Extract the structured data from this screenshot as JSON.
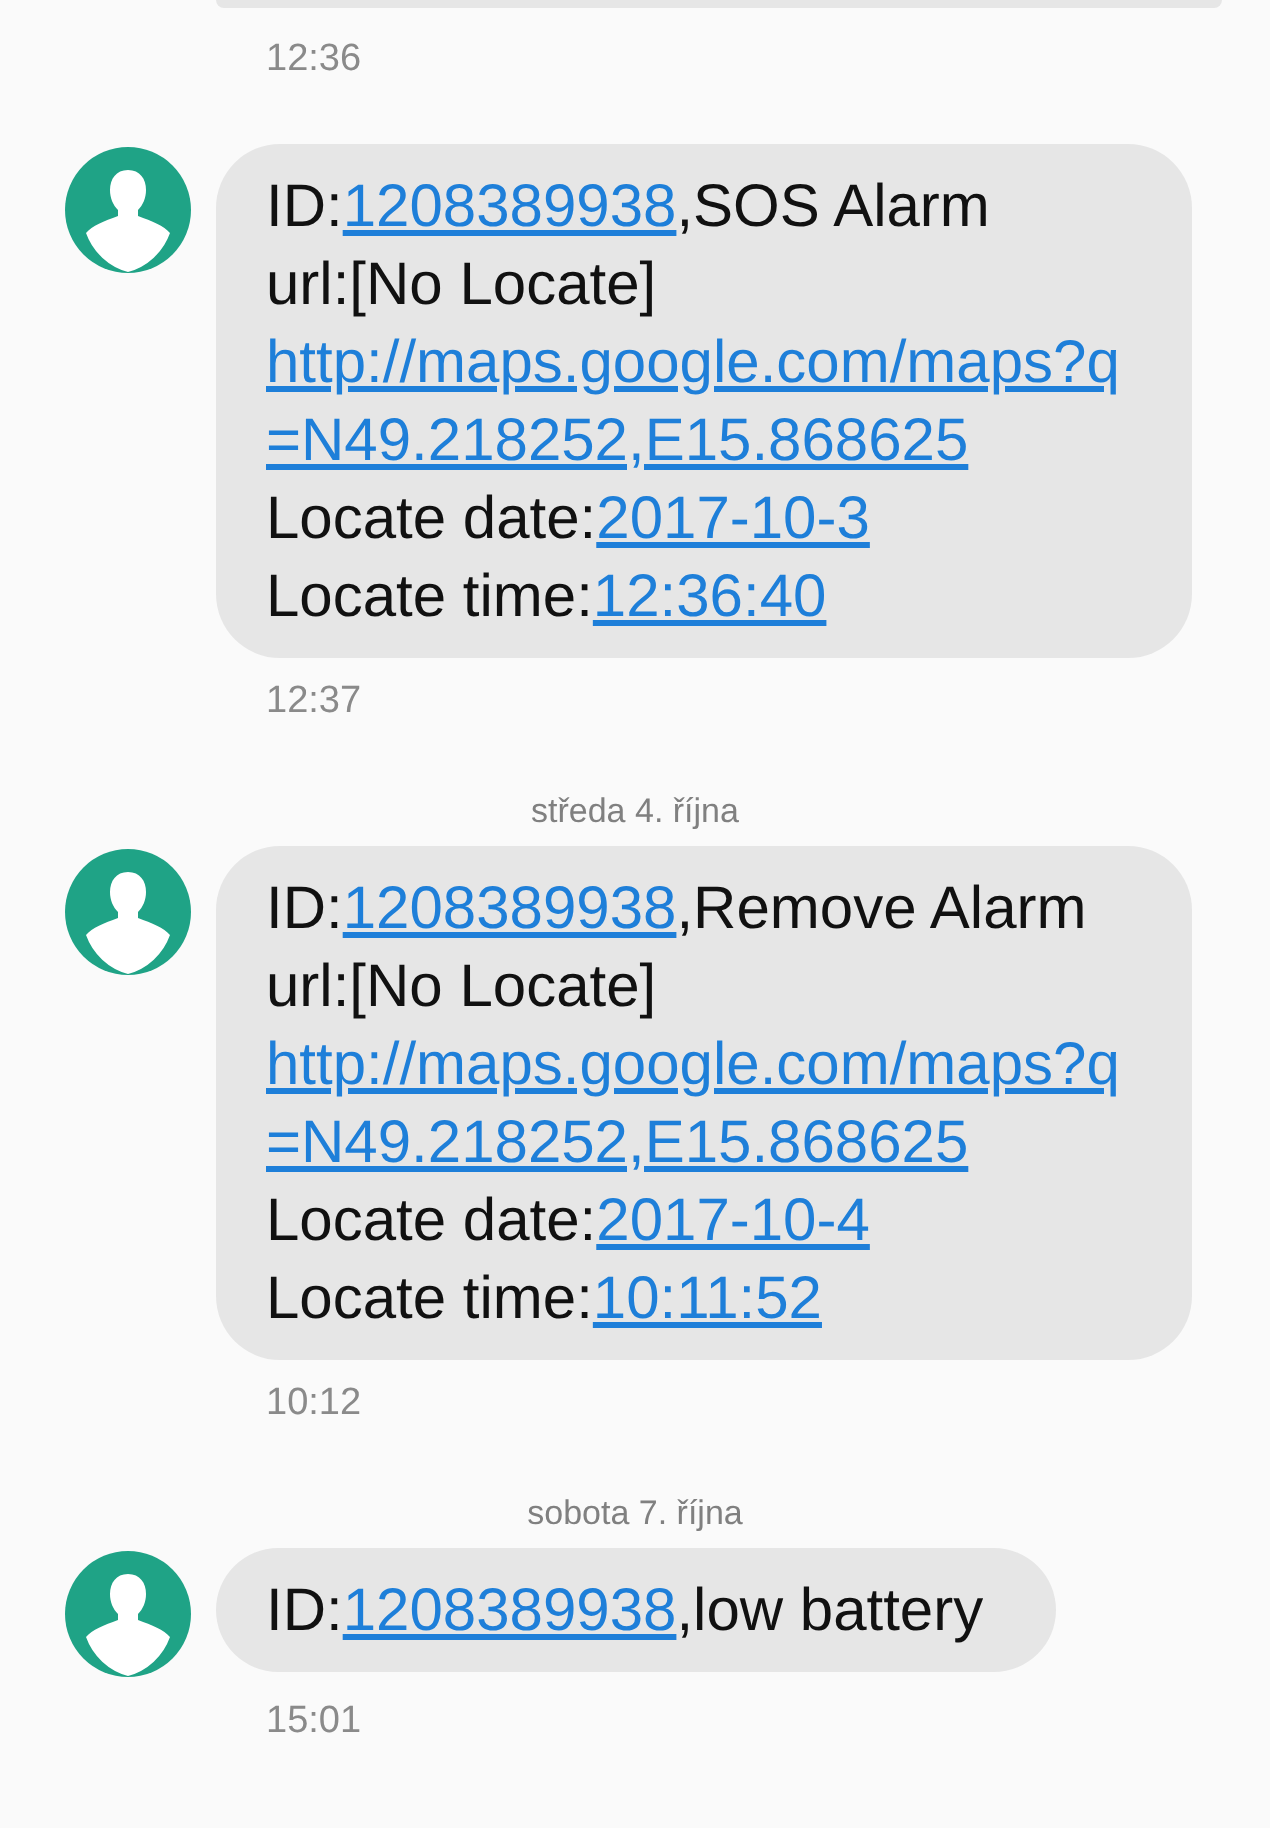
{
  "items": [
    {
      "kind": "time",
      "text": "12:36"
    },
    {
      "kind": "message",
      "lines": [
        [
          {
            "text": "ID:",
            "link": false
          },
          {
            "text": "1208389938",
            "link": true
          },
          {
            "text": ",SOS Alarm",
            "link": false
          }
        ],
        [
          {
            "text": "url:[No Locate]",
            "link": false
          }
        ],
        [
          {
            "text": "http://maps.google.com/maps?q",
            "link": true
          }
        ],
        [
          {
            "text": "=N49.218252,E15.868625",
            "link": true
          }
        ],
        [
          {
            "text": "Locate date:",
            "link": false
          },
          {
            "text": "2017-10-3",
            "link": true
          }
        ],
        [
          {
            "text": "Locate time:",
            "link": false
          },
          {
            "text": "12:36:40",
            "link": true
          }
        ]
      ]
    },
    {
      "kind": "time",
      "text": "12:37"
    },
    {
      "kind": "date",
      "text": "středa 4. října"
    },
    {
      "kind": "message",
      "lines": [
        [
          {
            "text": "ID:",
            "link": false
          },
          {
            "text": "1208389938",
            "link": true
          },
          {
            "text": ",Remove Alarm",
            "link": false
          }
        ],
        [
          {
            "text": "url:[No Locate]",
            "link": false
          }
        ],
        [
          {
            "text": "http://maps.google.com/maps?q",
            "link": true
          }
        ],
        [
          {
            "text": "=N49.218252,E15.868625",
            "link": true
          }
        ],
        [
          {
            "text": "Locate date:",
            "link": false
          },
          {
            "text": "2017-10-4",
            "link": true
          }
        ],
        [
          {
            "text": "Locate time:",
            "link": false
          },
          {
            "text": "10:11:52",
            "link": true
          }
        ]
      ]
    },
    {
      "kind": "time",
      "text": "10:12"
    },
    {
      "kind": "date",
      "text": "sobota 7. října"
    },
    {
      "kind": "message",
      "lines": [
        [
          {
            "text": "ID:",
            "link": false
          },
          {
            "text": "1208389938",
            "link": true
          },
          {
            "text": ",low battery",
            "link": false
          }
        ]
      ]
    },
    {
      "kind": "time",
      "text": "15:01"
    }
  ]
}
